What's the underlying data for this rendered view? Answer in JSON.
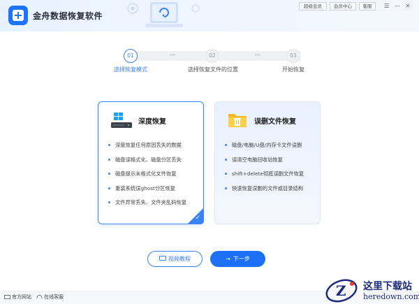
{
  "app": {
    "title": "金舟数据恢复软件"
  },
  "header": {
    "buttons": [
      "超级会员",
      "会员中心",
      "客服"
    ],
    "window_controls": [
      "☰",
      "—",
      "✕"
    ]
  },
  "steps": [
    {
      "num": "01",
      "label": "选择恢复模式",
      "active": true
    },
    {
      "num": "02",
      "label": "选择恢复文件的位置",
      "active": false
    },
    {
      "num": "03",
      "label": "开始恢复",
      "active": false
    }
  ],
  "cards": {
    "deep": {
      "title": "深度恢复",
      "icon": "windows-drive-icon",
      "selected": true,
      "items": [
        "深度恢复任何原因丢失的数据",
        "磁盘误格式化、磁盘分区丢失",
        "磁盘提示未格式化文件恢复",
        "重装系统误ghost分区恢复",
        "文件异常丢失、文件夹乱码恢复"
      ]
    },
    "deleted": {
      "title": "误删文件恢复",
      "icon": "folder-trash-icon",
      "selected": false,
      "items": [
        "磁盘/电脑/U盘/内存卡文件误删",
        "误清空电脑回收站恢复",
        "shift+delete彻底误删文件恢复",
        "快速恢复误删的文件或目录结构"
      ]
    }
  },
  "actions": {
    "tutorial": "视频教程",
    "next": "下一步"
  },
  "footer": {
    "website": "官方网站",
    "support": "在线客服"
  },
  "watermark": {
    "name": "这里下载站",
    "domain": "heredown.com"
  },
  "colors": {
    "accent": "#1d6ff5",
    "accent_light": "#3b82f6"
  }
}
